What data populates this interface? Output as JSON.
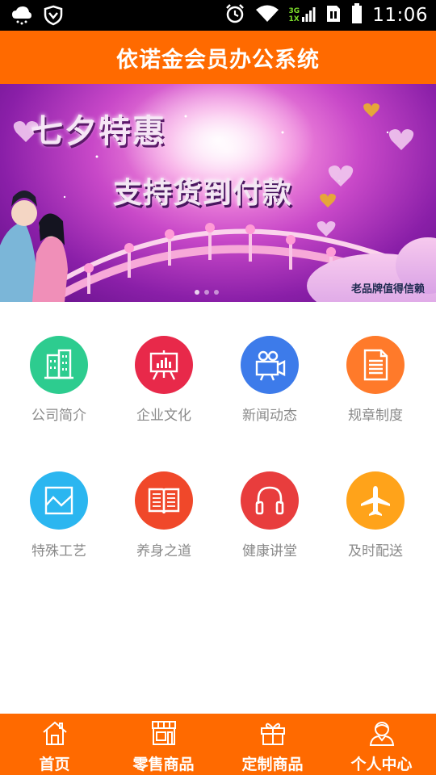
{
  "status_bar": {
    "time": "11:06",
    "network_top": "3G",
    "network_bottom": "1X",
    "icons": [
      "cloud-icon",
      "shield-icon",
      "alarm-icon",
      "wifi-icon",
      "signal-icon",
      "sim-icon",
      "battery-icon"
    ]
  },
  "header": {
    "title": "依诺金会员办公系统"
  },
  "banner": {
    "promo_line_1": "七夕特惠",
    "promo_line_2": "支持货到付款",
    "slogan": "老品牌值得信赖"
  },
  "menu": {
    "items": [
      {
        "label": "公司简介",
        "icon": "building-icon",
        "color": "#2dcc8f"
      },
      {
        "label": "企业文化",
        "icon": "presentation-board-icon",
        "color": "#e8294a"
      },
      {
        "label": "新闻动态",
        "icon": "video-camera-icon",
        "color": "#3d7bea"
      },
      {
        "label": "规章制度",
        "icon": "document-icon",
        "color": "#ff7a2a"
      },
      {
        "label": "特殊工艺",
        "icon": "line-chart-icon",
        "color": "#2bb6f0"
      },
      {
        "label": "养身之道",
        "icon": "open-book-icon",
        "color": "#f0482a"
      },
      {
        "label": "健康讲堂",
        "icon": "headphones-icon",
        "color": "#e83d3d"
      },
      {
        "label": "及时配送",
        "icon": "airplane-icon",
        "color": "#ffa31a"
      }
    ]
  },
  "bottom_nav": {
    "items": [
      {
        "label": "首页",
        "icon": "home-icon"
      },
      {
        "label": "零售商品",
        "icon": "storefront-icon"
      },
      {
        "label": "定制商品",
        "icon": "gift-icon"
      },
      {
        "label": "个人中心",
        "icon": "user-icon"
      }
    ]
  },
  "colors": {
    "brand": "#ff6a00",
    "label_gray": "#8a8a8a"
  }
}
